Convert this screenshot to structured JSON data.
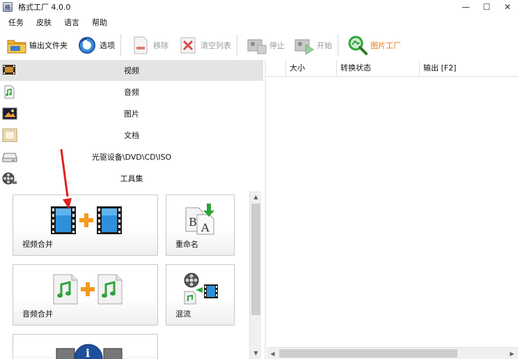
{
  "window": {
    "title": "格式工厂 4.0.0",
    "app_icon_glyph": "格",
    "minimize": "—",
    "maximize": "☐",
    "close": "✕"
  },
  "menu": [
    "任务",
    "皮肤",
    "语言",
    "帮助"
  ],
  "toolbar": {
    "output_folder": "输出文件夹",
    "options": "选项",
    "remove": "移除",
    "clear_list": "清空列表",
    "stop": "停止",
    "start": "开始",
    "picture_factory": "图片工厂"
  },
  "categories": [
    {
      "label": "视频",
      "icon": "film-icon",
      "active": true
    },
    {
      "label": "音频",
      "icon": "music-note-icon",
      "active": false
    },
    {
      "label": "图片",
      "icon": "picture-icon",
      "active": false
    },
    {
      "label": "文档",
      "icon": "document-icon",
      "active": false
    },
    {
      "label": "光驱设备\\DVD\\CD\\ISO",
      "icon": "disc-drive-icon",
      "active": false
    },
    {
      "label": "工具集",
      "icon": "film-reel-icon",
      "active": false
    }
  ],
  "tools": [
    {
      "label": "视频合并",
      "icon": "video-merge-icon"
    },
    {
      "label": "重命名",
      "icon": "rename-icon"
    },
    {
      "label": "音频合并",
      "icon": "audio-merge-icon"
    },
    {
      "label": "混流",
      "icon": "mux-icon"
    },
    {
      "label": "",
      "icon": "media-info-icon"
    }
  ],
  "table": {
    "columns": [
      "",
      "大小",
      "转换状态",
      "输出 [F2]"
    ]
  },
  "scroll": {
    "up": "▲",
    "down": "▼",
    "left": "◀",
    "right": "▶"
  },
  "colors": {
    "accent_orange": "#e07b10",
    "accent_green": "#2ea43a",
    "film_blue": "#2f8fd8",
    "arrow_red": "#e02020",
    "active_row": "#e4e4e4"
  }
}
